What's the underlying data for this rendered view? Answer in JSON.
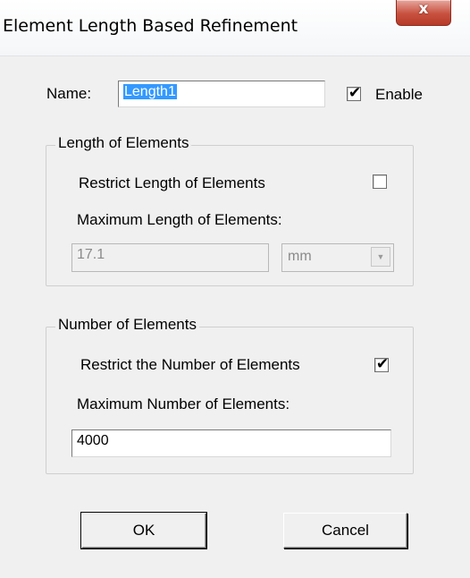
{
  "window": {
    "title": "Element Length Based Refinement",
    "close_label": "x"
  },
  "name_row": {
    "label": "Name:",
    "value": "Length1",
    "enable_label": "Enable",
    "enable_checked": true
  },
  "length_group": {
    "legend": "Length of Elements",
    "restrict_label": "Restrict Length of Elements",
    "restrict_checked": false,
    "max_label": "Maximum Length of Elements:",
    "max_value": "17.1",
    "unit_value": "mm"
  },
  "number_group": {
    "legend": "Number of Elements",
    "restrict_label": "Restrict the Number of Elements",
    "restrict_checked": true,
    "max_label": "Maximum Number of  Elements:",
    "max_value": "4000"
  },
  "buttons": {
    "ok_label": "OK",
    "cancel_label": "Cancel"
  },
  "glyphs": {
    "check": "✔",
    "dropdown": "▼"
  }
}
